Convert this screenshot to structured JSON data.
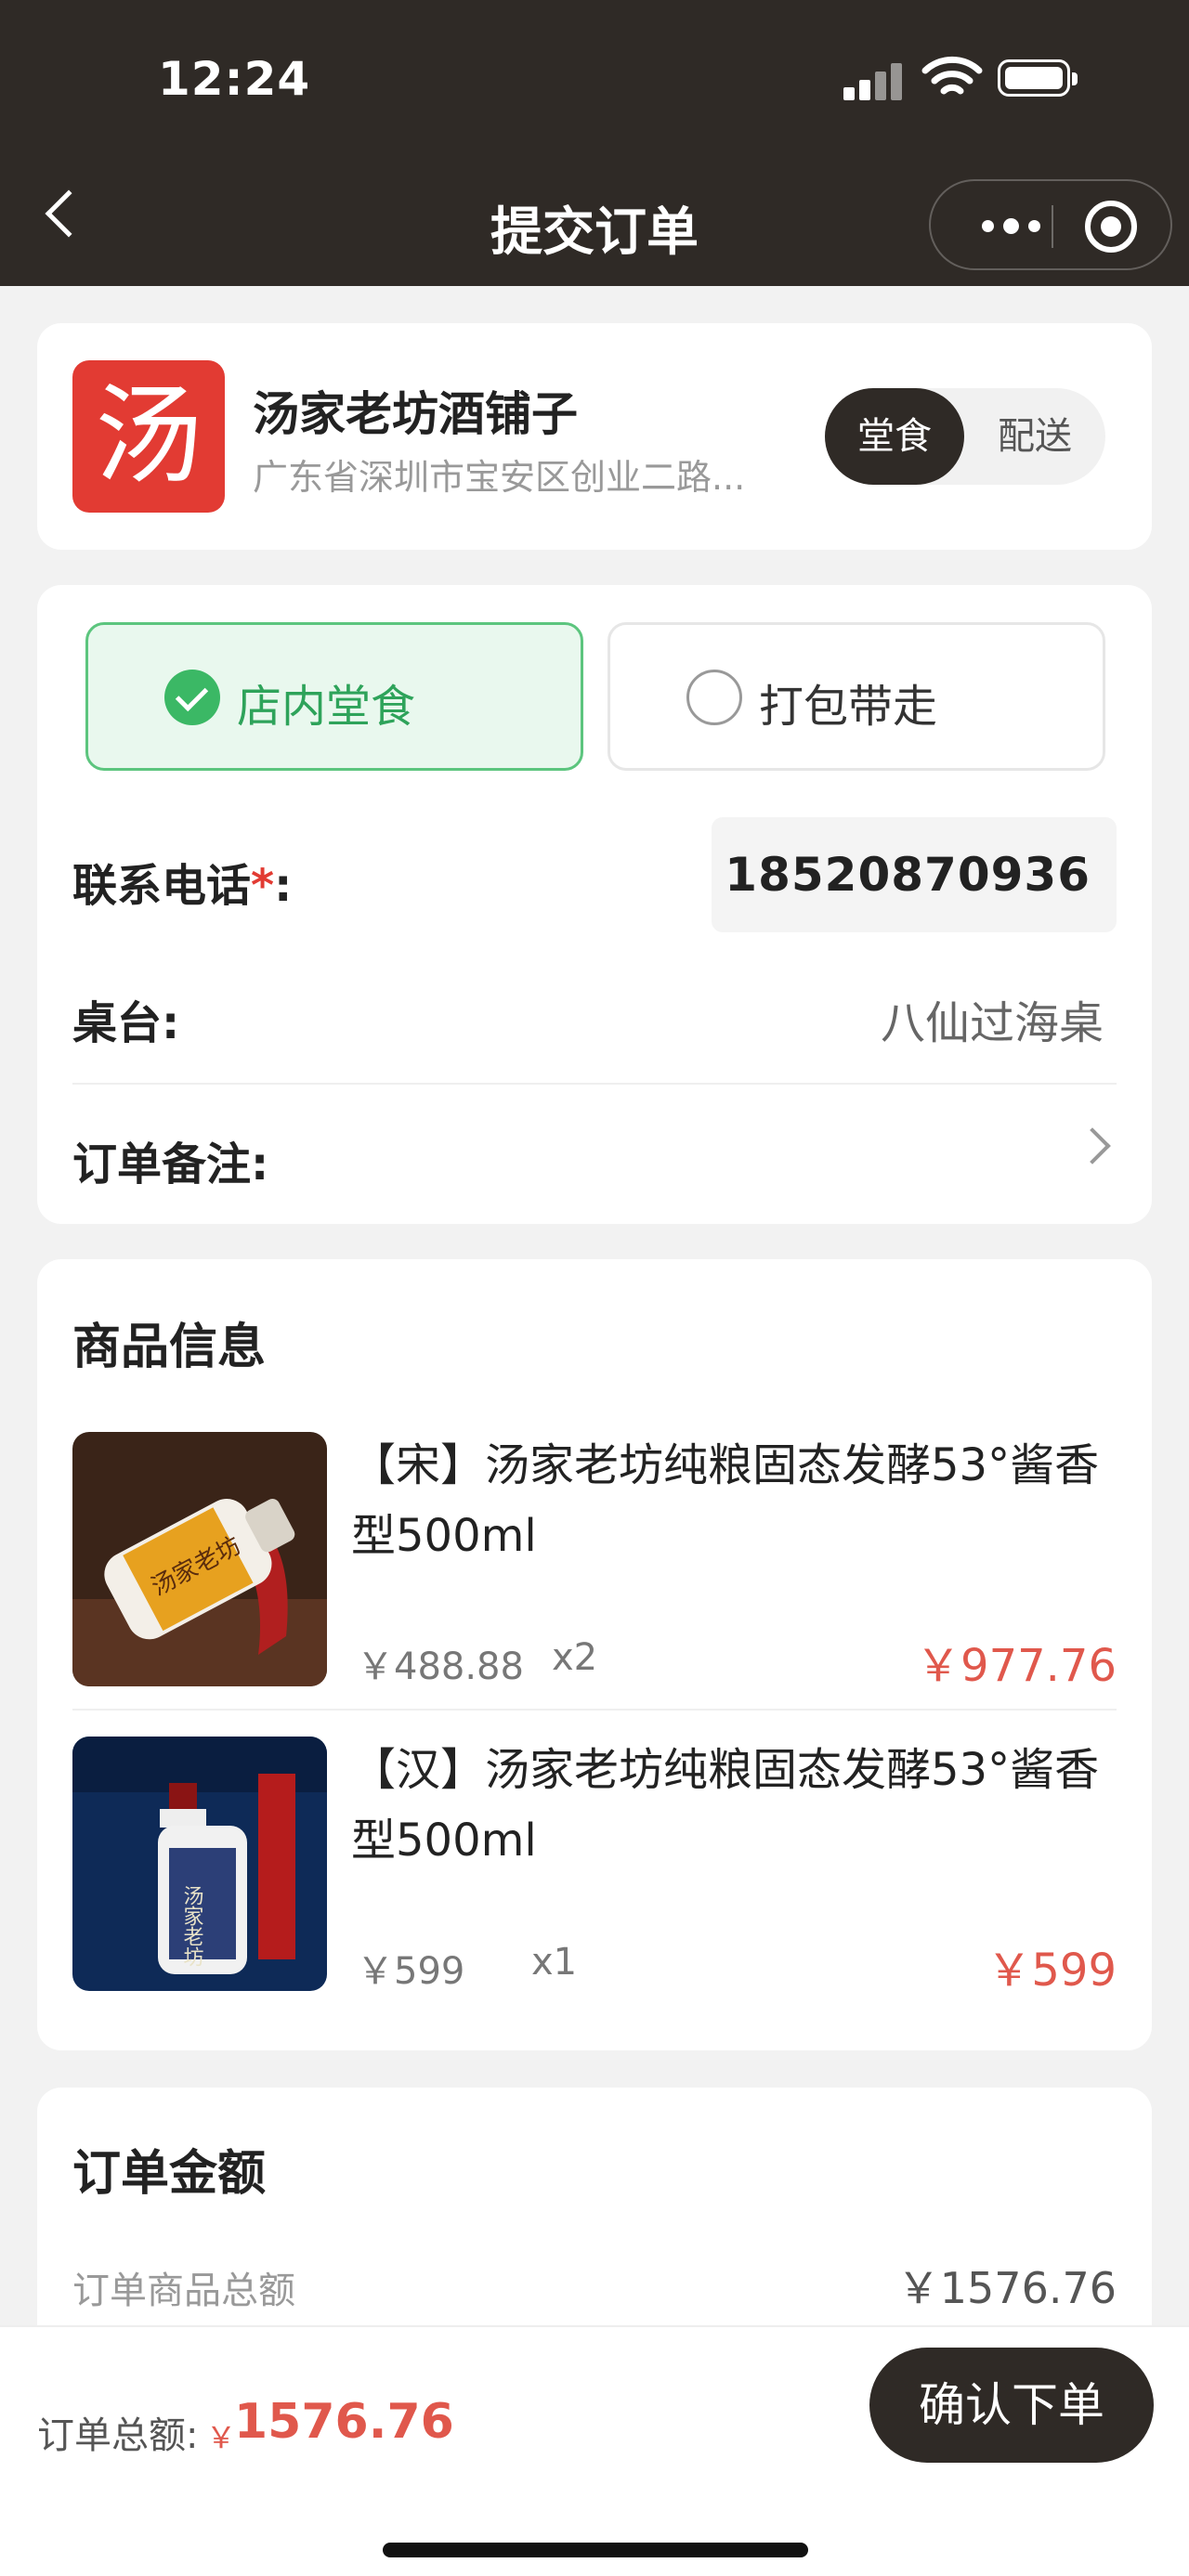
{
  "status_bar": {
    "time": "12:24"
  },
  "nav": {
    "title": "提交订单"
  },
  "store": {
    "logo_glyph": "汤",
    "name": "汤家老坊酒铺子",
    "address": "广东省深圳市宝安区创业二路...",
    "mode_selected": "堂食",
    "mode_other": "配送"
  },
  "dining": {
    "option_selected": "店内堂食",
    "option_other": "打包带走",
    "phone_label": "联系电话",
    "phone_required_mark": "*",
    "phone_colon": ":",
    "phone_value": "18520870936",
    "table_label": "桌台:",
    "table_value": "八仙过海桌",
    "remark_label": "订单备注:"
  },
  "products": {
    "title": "商品信息",
    "items": [
      {
        "name": "【宋】汤家老坊纯粮固态发酵53°酱香型500ml",
        "unit_price": "￥488.88",
        "qty": "x2",
        "total": "￥977.76",
        "image": "yellow-label-baijiu-bottle"
      },
      {
        "name": "【汉】汤家老坊纯粮固态发酵53°酱香型500ml",
        "unit_price": "￥599",
        "qty": "x1",
        "total": "￥599",
        "image": "blue-label-baijiu-bottle"
      }
    ]
  },
  "amount": {
    "title": "订单金额",
    "subtotal_label": "订单商品总额",
    "subtotal_value": "￥1576.76"
  },
  "footer": {
    "total_label": "订单总额:",
    "currency": "￥",
    "total_value": "1576.76",
    "confirm_label": "确认下单"
  },
  "colors": {
    "dark": "#2f2a26",
    "price_red": "#e0584c",
    "green": "#3bb865",
    "brand_red": "#e23b33"
  }
}
